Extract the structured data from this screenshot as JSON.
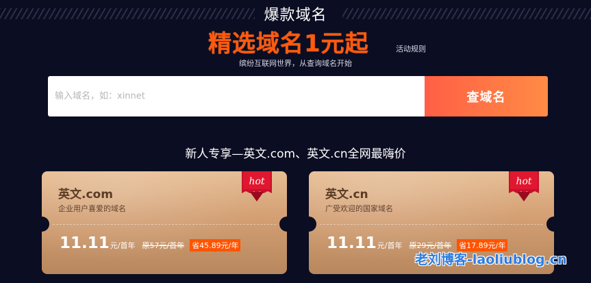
{
  "header": {
    "eyebrow": "爆款域名",
    "headline": "精选域名1元起",
    "rules_link": "活动规则",
    "tagline": "缤纷互联网世界，从查询域名开始"
  },
  "search": {
    "placeholder": "输入域名，如：xinnet",
    "button_label": "查域名"
  },
  "promo": {
    "title": "新人专享—英文.com、英文.cn全网最嗨价",
    "cards": [
      {
        "name": "英文.com",
        "desc": "企业用户喜爱的域名",
        "badge": "hot",
        "price": "11.11",
        "price_unit": "元/首年",
        "original": "原57元/首年",
        "save": "省45.89元/年"
      },
      {
        "name": "英文.cn",
        "desc": "广受欢迎的国家域名",
        "badge": "hot",
        "price": "11.11",
        "price_unit": "元/首年",
        "original": "原29元/首年",
        "save": "省17.89元/年"
      }
    ]
  },
  "watermark": "老刘博客-laoliublog.cn",
  "colors": {
    "background": "#0b0d22",
    "accent_orange": "#ff5a0f",
    "button_gradient_start": "#ff5f45",
    "button_gradient_end": "#ff8b45",
    "badge_red": "#c8102e"
  },
  "icons": {
    "hot_badge": "hot-ribbon-icon"
  }
}
